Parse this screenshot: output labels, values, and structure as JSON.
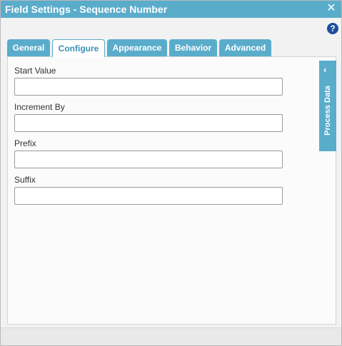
{
  "window": {
    "title": "Field Settings - Sequence Number",
    "close_glyph": "✕"
  },
  "help": {
    "glyph": "?"
  },
  "tabs": [
    {
      "label": "General",
      "active": false
    },
    {
      "label": "Configure",
      "active": true
    },
    {
      "label": "Appearance",
      "active": false
    },
    {
      "label": "Behavior",
      "active": false
    },
    {
      "label": "Advanced",
      "active": false
    }
  ],
  "fields": [
    {
      "label": "Start Value",
      "value": ""
    },
    {
      "label": "Increment By",
      "value": ""
    },
    {
      "label": "Prefix",
      "value": ""
    },
    {
      "label": "Suffix",
      "value": ""
    }
  ],
  "side_panel": {
    "label": "Process Data",
    "chevron": "‹"
  },
  "colors": {
    "accent": "#5aaccb",
    "help": "#1e4e9c",
    "active_tab_text": "#3a8fb3"
  }
}
